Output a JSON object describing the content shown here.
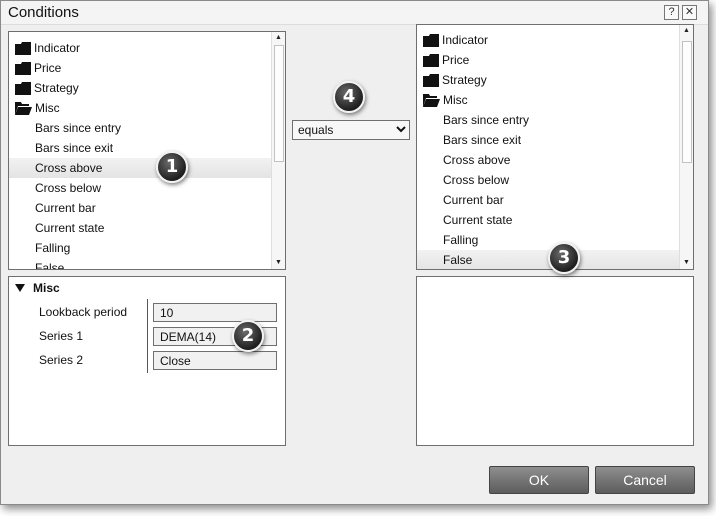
{
  "window": {
    "title": "Conditions",
    "help_glyph": "?",
    "close_glyph": "✕"
  },
  "left_list": {
    "folders": [
      "Indicator",
      "Price",
      "Strategy",
      "Misc"
    ],
    "items": [
      "Bars since entry",
      "Bars since exit",
      "Cross above",
      "Cross below",
      "Current bar",
      "Current state",
      "Falling",
      "False"
    ],
    "selected": "Cross above"
  },
  "right_list": {
    "folders": [
      "Indicator",
      "Price",
      "Strategy",
      "Misc"
    ],
    "items": [
      "Bars since entry",
      "Bars since exit",
      "Cross above",
      "Cross below",
      "Current bar",
      "Current state",
      "Falling",
      "False"
    ],
    "selected": "False"
  },
  "operator": {
    "selected": "equals"
  },
  "properties": {
    "section": "Misc",
    "rows": [
      {
        "label": "Lookback period",
        "value": "10"
      },
      {
        "label": "Series 1",
        "value": "DEMA(14)"
      },
      {
        "label": "Series 2",
        "value": "Close"
      }
    ]
  },
  "callouts": [
    "1",
    "2",
    "3",
    "4"
  ],
  "buttons": {
    "ok": "OK",
    "cancel": "Cancel"
  },
  "icons": [
    "folder-closed-icon",
    "folder-open-icon",
    "scroll-up-icon",
    "scroll-down-icon",
    "dropdown-arrow-icon",
    "expand-triangle-icon"
  ]
}
